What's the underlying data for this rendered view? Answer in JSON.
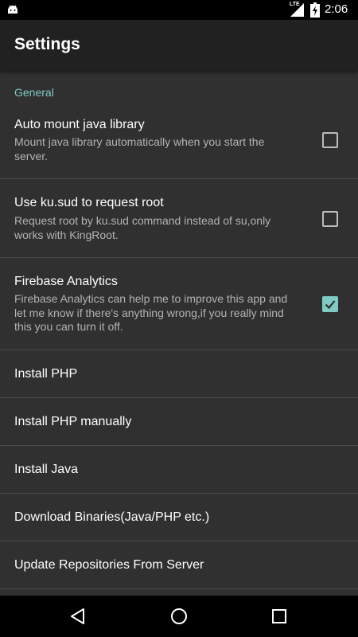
{
  "status_bar": {
    "network_label": "LTE",
    "time": "2:06"
  },
  "app_bar": {
    "title": "Settings"
  },
  "category": {
    "label": "General"
  },
  "preferences": [
    {
      "title": "Auto mount java library",
      "summary": "Mount java library automatically when you start the server.",
      "checked": false
    },
    {
      "title": "Use ku.sud to request root",
      "summary": "Request root by ku.sud command instead of su,only works with KingRoot.",
      "checked": false
    },
    {
      "title": "Firebase Analytics",
      "summary": "Firebase Analytics can help me to improve this app and let me know if there's anything wrong,if you really mind this you can turn it off.",
      "checked": true
    },
    {
      "title": "Install PHP"
    },
    {
      "title": "Install PHP manually"
    },
    {
      "title": "Install Java"
    },
    {
      "title": "Download Binaries(Java/PHP etc.)"
    },
    {
      "title": "Update Repositories From Server"
    }
  ],
  "nav_bar": {
    "icons": [
      "back-icon",
      "home-icon",
      "recents-icon"
    ]
  },
  "colors": {
    "accent": "#80cbc4",
    "background": "#303030",
    "app_bar": "#212121"
  }
}
